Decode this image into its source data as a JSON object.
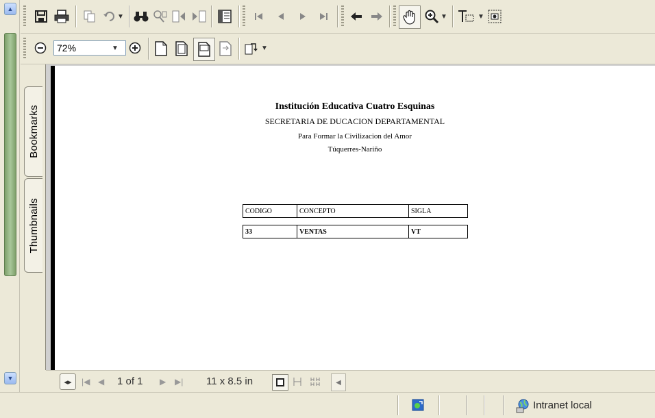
{
  "toolbar": {
    "zoom_value": "72%"
  },
  "nav": {
    "tabs": [
      {
        "label": "Bookmarks"
      },
      {
        "label": "Thumbnails"
      }
    ]
  },
  "document": {
    "title": "Institución Educativa Cuatro Esquinas",
    "subtitle": "SECRETARIA DE DUCACION DEPARTAMENTAL",
    "motto": "Para Formar la Civilizacion del Amor",
    "location": "Túquerres-Nariño",
    "table": {
      "headers": [
        "CODIGO",
        "CONCEPTO",
        "SIGLA"
      ],
      "rows": [
        [
          "33",
          "VENTAS",
          "VT"
        ]
      ]
    }
  },
  "bottom": {
    "page_indicator": "1 of 1",
    "page_size": "11 x 8.5 in"
  },
  "status": {
    "zone_label": "Intranet local"
  },
  "colors": {
    "accent_green": "#7ea06a",
    "border_blue": "#7f9db9"
  }
}
